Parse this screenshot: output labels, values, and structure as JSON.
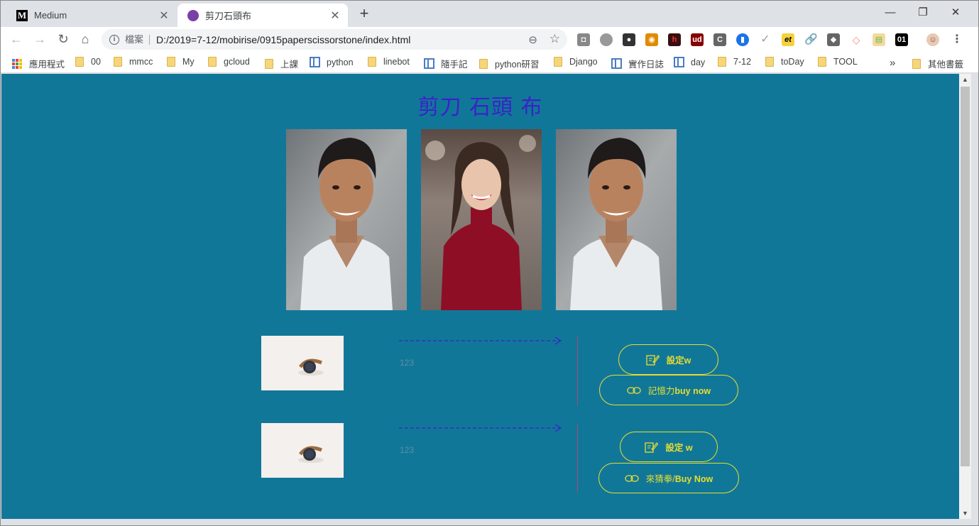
{
  "tabs": [
    {
      "title": "Medium",
      "favicon": "M"
    },
    {
      "title": "剪刀石頭布"
    }
  ],
  "omnibox": {
    "scheme_label": "檔案",
    "url": "D:/2019=7-12/mobirise/0915paperscissorstone/index.html"
  },
  "extension_badges": {
    "et": "et",
    "ud": "ud",
    "c": "C",
    "num": "01"
  },
  "bookmarks": [
    {
      "label": "應用程式",
      "type": "apps"
    },
    {
      "label": "00",
      "type": "folder"
    },
    {
      "label": "mmcc",
      "type": "folder"
    },
    {
      "label": "My",
      "type": "folder"
    },
    {
      "label": "gcloud",
      "type": "folder"
    },
    {
      "label": "上課",
      "type": "folder"
    },
    {
      "label": "python",
      "type": "page"
    },
    {
      "label": "linebot",
      "type": "folder"
    },
    {
      "label": "隨手記",
      "type": "page"
    },
    {
      "label": "python研習",
      "type": "folder"
    },
    {
      "label": "Django",
      "type": "folder"
    },
    {
      "label": "實作日誌",
      "type": "page"
    },
    {
      "label": "day",
      "type": "page"
    },
    {
      "label": "7-12",
      "type": "folder"
    },
    {
      "label": "toDay",
      "type": "folder"
    },
    {
      "label": "TOOL",
      "type": "folder"
    }
  ],
  "bookmarks_overflow": "»",
  "other_bookmarks": "其他書籤",
  "page": {
    "title": "剪刀 石頭 布",
    "background": "#117799",
    "title_color": "#3a22c8",
    "accent_color": "#e7de2f",
    "rows": [
      {
        "text": "123",
        "button1": "設定w",
        "button2_prefix": "記憶力",
        "button2_suffix": "buy now"
      },
      {
        "text": "123",
        "button1": "設定 w",
        "button2_prefix": "來猜拳/",
        "button2_suffix": "Buy Now"
      }
    ]
  }
}
